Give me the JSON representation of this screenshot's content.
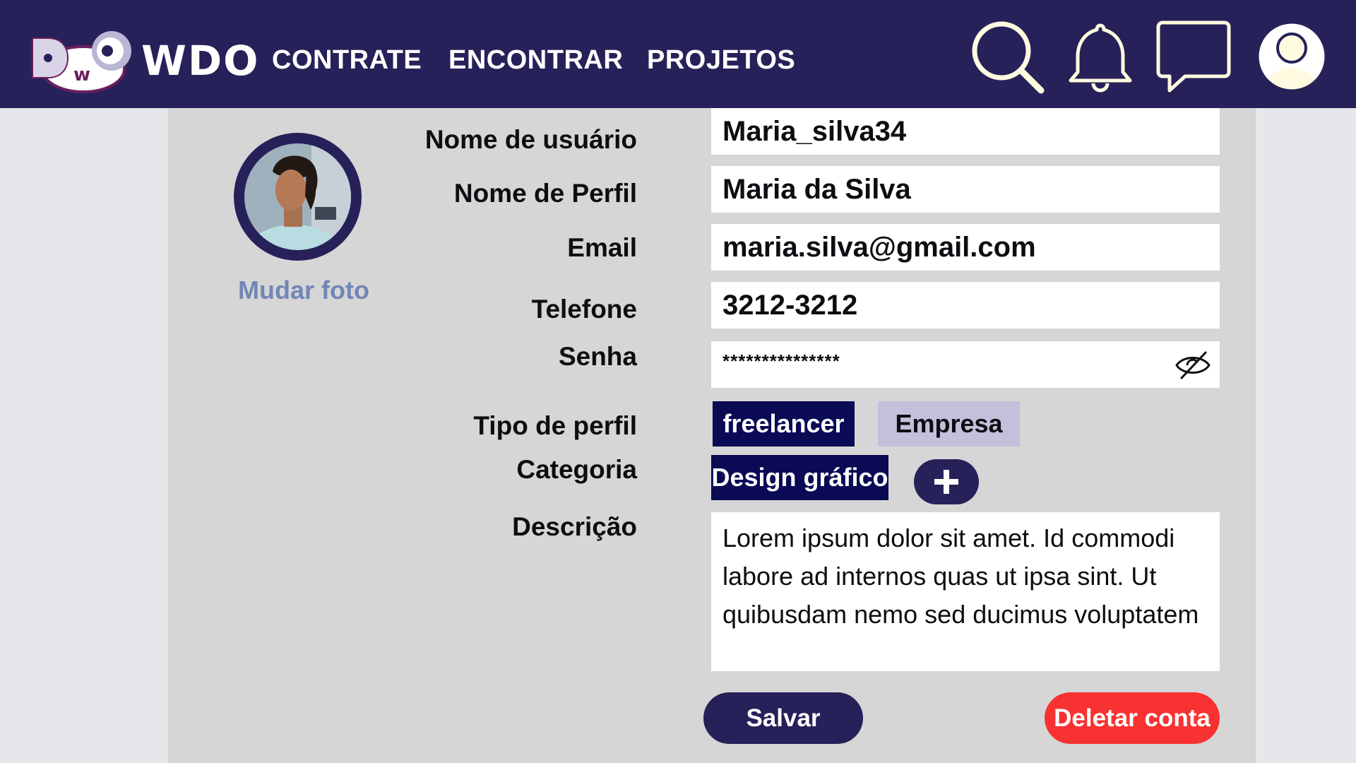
{
  "header": {
    "brand": "WDO",
    "nav": [
      "CONTRATE",
      "ENCONTRAR",
      "PROJETOS"
    ],
    "icons": [
      "search-icon",
      "bell-icon",
      "chat-icon",
      "user-icon"
    ],
    "color": "#272159"
  },
  "profile": {
    "change_photo": "Mudar foto",
    "labels": {
      "username": "Nome de usuário",
      "profile_name": "Nome de Perfil",
      "email": "Email",
      "phone": "Telefone",
      "password": "Senha",
      "profile_type": "Tipo de perfil",
      "category": "Categoria",
      "description": "Descrição"
    },
    "values": {
      "username": "Maria_silva34",
      "profile_name": "Maria da Silva",
      "email": "maria.silva@gmail.com",
      "phone": "3212-3212",
      "password": "***************",
      "description": "Lorem ipsum dolor sit amet. Id commodi labore ad internos quas ut ipsa sint. Ut quibusdam nemo sed ducimus voluptatem"
    },
    "profile_types": [
      {
        "label": "freelancer",
        "selected": true
      },
      {
        "label": "Empresa",
        "selected": false
      }
    ],
    "categories": [
      "Design gráfico"
    ],
    "add_category_icon": "plus-icon",
    "password_toggle_icon": "eye-off-icon"
  },
  "actions": {
    "save": "Salvar",
    "delete": "Deletar conta",
    "save_color": "#272159",
    "delete_color": "#f83232"
  }
}
